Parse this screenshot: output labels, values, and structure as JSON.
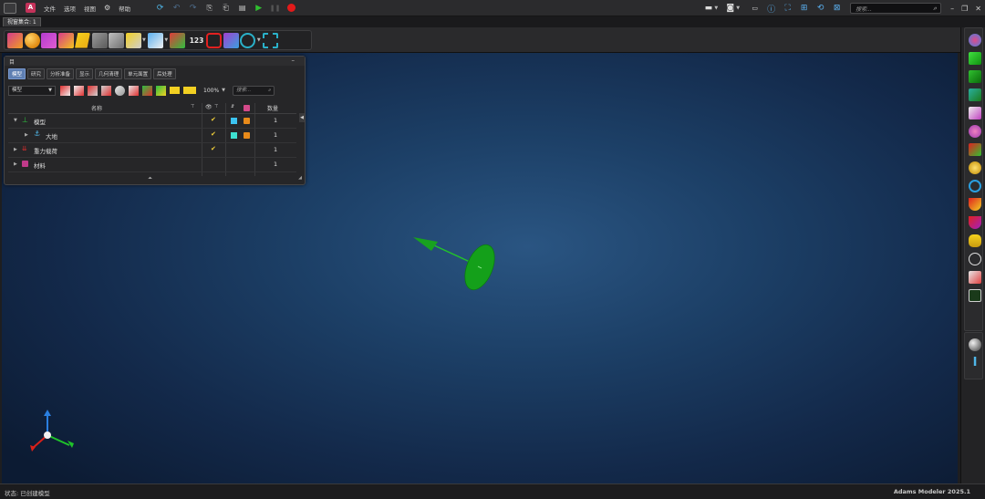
{
  "menubar": {
    "items": [
      "文件",
      "选项",
      "视图",
      "帮助"
    ],
    "search_placeholder": "搜索..."
  },
  "view_tab": {
    "label": "视窗集合: 1"
  },
  "ribbon": {
    "counter_label": "123"
  },
  "browser": {
    "title": "目",
    "tabs": [
      "模型",
      "研究",
      "分析准备",
      "显示",
      "几何清理",
      "单元面置",
      "后处理"
    ],
    "active_tab": "模型",
    "filter_value": "模型",
    "zoom": "100%",
    "search_placeholder": "搜索...",
    "columns": {
      "name": "名称",
      "count": "数量"
    },
    "rows": [
      {
        "name": "模型",
        "count": "1",
        "checked": true,
        "swatch": "#3cc3f0"
      },
      {
        "name": "大地",
        "count": "1",
        "checked": true,
        "swatch": "#3ee0d0"
      },
      {
        "name": "重力载荷",
        "count": "1",
        "checked": true,
        "swatch": ""
      },
      {
        "name": "材料",
        "count": "1",
        "checked": false,
        "swatch": ""
      }
    ]
  },
  "status": {
    "text": "状态: 已创建模型",
    "version": "Adams Modeler 2025.1"
  },
  "colors": {
    "accent": "#5e7fb2",
    "part_green": "#16a218",
    "viewport_center": "#2a5582"
  }
}
